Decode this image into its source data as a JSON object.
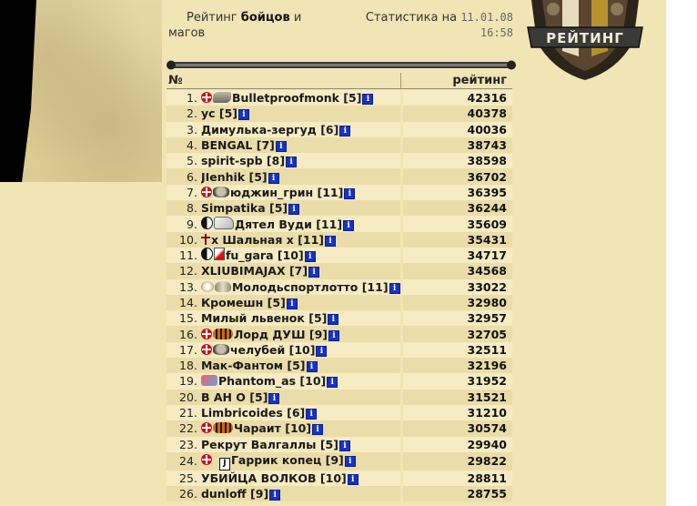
{
  "header": {
    "title_prefix": "Рейтинг",
    "title_bold": "бойцов",
    "title_conj": "и",
    "title_rest": "магов",
    "stats_label": "Статистика на",
    "stats_date": "11.01.08",
    "stats_time": "16:58"
  },
  "logo": {
    "text": "РЕЙТИНГ"
  },
  "columns": {
    "num": "№",
    "rating": "рейтинг"
  },
  "colors": {
    "accent": "#1433c8",
    "paper": "#f2e5b5",
    "row_alt": "#ebdda9"
  },
  "rows": [
    {
      "pos": "1.",
      "name": "Bulletproofmonk",
      "level": "[5]",
      "score": "42316",
      "badges": [
        "cross",
        "wing"
      ]
    },
    {
      "pos": "2.",
      "name": "yc",
      "level": "[5]",
      "score": "40378",
      "badges": []
    },
    {
      "pos": "3.",
      "name": "Димулька-зергуд",
      "level": "[6]",
      "score": "40036",
      "badges": []
    },
    {
      "pos": "4.",
      "name": "BENGAL",
      "level": "[7]",
      "score": "38743",
      "badges": []
    },
    {
      "pos": "5.",
      "name": "spirit-spb",
      "level": "[8]",
      "score": "38598",
      "badges": []
    },
    {
      "pos": "6.",
      "name": "JIenhik",
      "level": "[5]",
      "score": "36702",
      "badges": []
    },
    {
      "pos": "7.",
      "name": "юджин_грин",
      "level": "[11]",
      "score": "36395",
      "badges": [
        "cross",
        "skull"
      ]
    },
    {
      "pos": "8.",
      "name": "Simpatika",
      "level": "[5]",
      "score": "36244",
      "badges": []
    },
    {
      "pos": "9.",
      "name": "Дятел Вуди",
      "level": "[11]",
      "score": "35609",
      "badges": [
        "yin",
        "hand"
      ]
    },
    {
      "pos": "10.",
      "name": "x Шальная x",
      "level": "[11]",
      "score": "35431",
      "badges": [
        "rcross"
      ]
    },
    {
      "pos": "11.",
      "name": "fu_gara",
      "level": "[10]",
      "score": "34717",
      "badges": [
        "yin",
        "pen"
      ]
    },
    {
      "pos": "12.",
      "name": "XLIUBIMAJAX",
      "level": "[7]",
      "score": "34568",
      "badges": []
    },
    {
      "pos": "13.",
      "name": "Молодьспортлотто",
      "level": "[11]",
      "score": "33022",
      "badges": [
        "orn",
        "orn2"
      ]
    },
    {
      "pos": "14.",
      "name": "Кромешн",
      "level": "[5]",
      "score": "32980",
      "badges": []
    },
    {
      "pos": "15.",
      "name": "Милый львенок",
      "level": "[5]",
      "score": "32957",
      "badges": []
    },
    {
      "pos": "16.",
      "name": "Лорд ДУШ",
      "level": "[9]",
      "score": "32705",
      "badges": [
        "cross",
        "tiger"
      ]
    },
    {
      "pos": "17.",
      "name": "челубей",
      "level": "[10]",
      "score": "32511",
      "badges": [
        "cross",
        "skull"
      ]
    },
    {
      "pos": "18.",
      "name": "Мак-Фантом",
      "level": "[5]",
      "score": "32196",
      "badges": []
    },
    {
      "pos": "19.",
      "name": "Phantom_as",
      "level": "[10]",
      "score": "31952",
      "badges": [
        "cube"
      ]
    },
    {
      "pos": "20.",
      "name": "В АН О",
      "level": "[5]",
      "score": "31521",
      "badges": []
    },
    {
      "pos": "21.",
      "name": "Limbricoides",
      "level": "[6]",
      "score": "31210",
      "badges": []
    },
    {
      "pos": "22.",
      "name": "Чараит",
      "level": "[10]",
      "score": "30574",
      "badges": [
        "cross",
        "tiger"
      ]
    },
    {
      "pos": "23.",
      "name": "Рекрут Валгаллы",
      "level": "[5]",
      "score": "29940",
      "badges": []
    },
    {
      "pos": "24.",
      "name": "Гаррик копец",
      "level": "[9]",
      "score": "29822",
      "badges": [
        "cross",
        "space",
        "card"
      ]
    },
    {
      "pos": "25.",
      "name": "УБИЙЦА ВОЛКОВ",
      "level": "[10]",
      "score": "28811",
      "badges": []
    },
    {
      "pos": "26.",
      "name": "dunloff",
      "level": "[9]",
      "score": "28755",
      "badges": []
    }
  ]
}
